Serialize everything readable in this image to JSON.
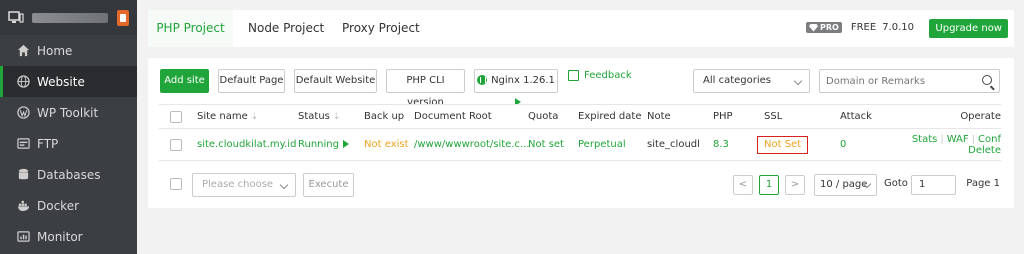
{
  "sidebar": {
    "items": [
      {
        "label": "Home",
        "icon": "home-icon"
      },
      {
        "label": "Website",
        "icon": "globe-icon"
      },
      {
        "label": "WP Toolkit",
        "icon": "wordpress-icon"
      },
      {
        "label": "FTP",
        "icon": "ftp-icon"
      },
      {
        "label": "Databases",
        "icon": "database-icon"
      },
      {
        "label": "Docker",
        "icon": "docker-icon"
      },
      {
        "label": "Monitor",
        "icon": "monitor-icon"
      }
    ],
    "active": "Website"
  },
  "tabs": [
    "PHP Project",
    "Node Project",
    "Proxy Project"
  ],
  "header": {
    "pro_label": "PRO",
    "free_label": "FREE",
    "version": "7.0.10",
    "upgrade_label": "Upgrade now"
  },
  "toolbar": {
    "add_site": "Add site",
    "default_page": "Default Page",
    "default_website": "Default Website",
    "php_cli": "PHP CLI version",
    "nginx": "Nginx 1.26.1",
    "feedback": "Feedback",
    "category": "All categories",
    "search_placeholder": "Domain or Remarks"
  },
  "table": {
    "headers": [
      "Site name",
      "Status",
      "Back up",
      "Document Root",
      "Quota",
      "Expired date",
      "Note",
      "PHP",
      "SSL",
      "Attack",
      "Operate"
    ],
    "row": {
      "site_name": "site.cloudkilat.my.id",
      "status": "Running",
      "backup": "Not exist",
      "doc_root": "/www/wwwroot/site.c...",
      "quota": "Not set",
      "expired": "Perpetual",
      "note": "site_cloudkila",
      "php": "8.3",
      "ssl": "Not Set",
      "attack": "0",
      "op_stats": "Stats",
      "op_waf": "WAF",
      "op_conf": "Conf",
      "op_delete": "Delete"
    }
  },
  "footer": {
    "batch_placeholder": "Please choose",
    "execute": "Execute",
    "prev": "<",
    "page": "1",
    "next": ">",
    "per_page": "10 / page",
    "goto_label": "Goto",
    "goto_value": "1",
    "page_label": "Page 1"
  },
  "colors": {
    "accent": "#20a53a",
    "sidebar_bg": "#3b3e43",
    "warning": "#f0a020",
    "highlight_border": "#d9211c"
  }
}
